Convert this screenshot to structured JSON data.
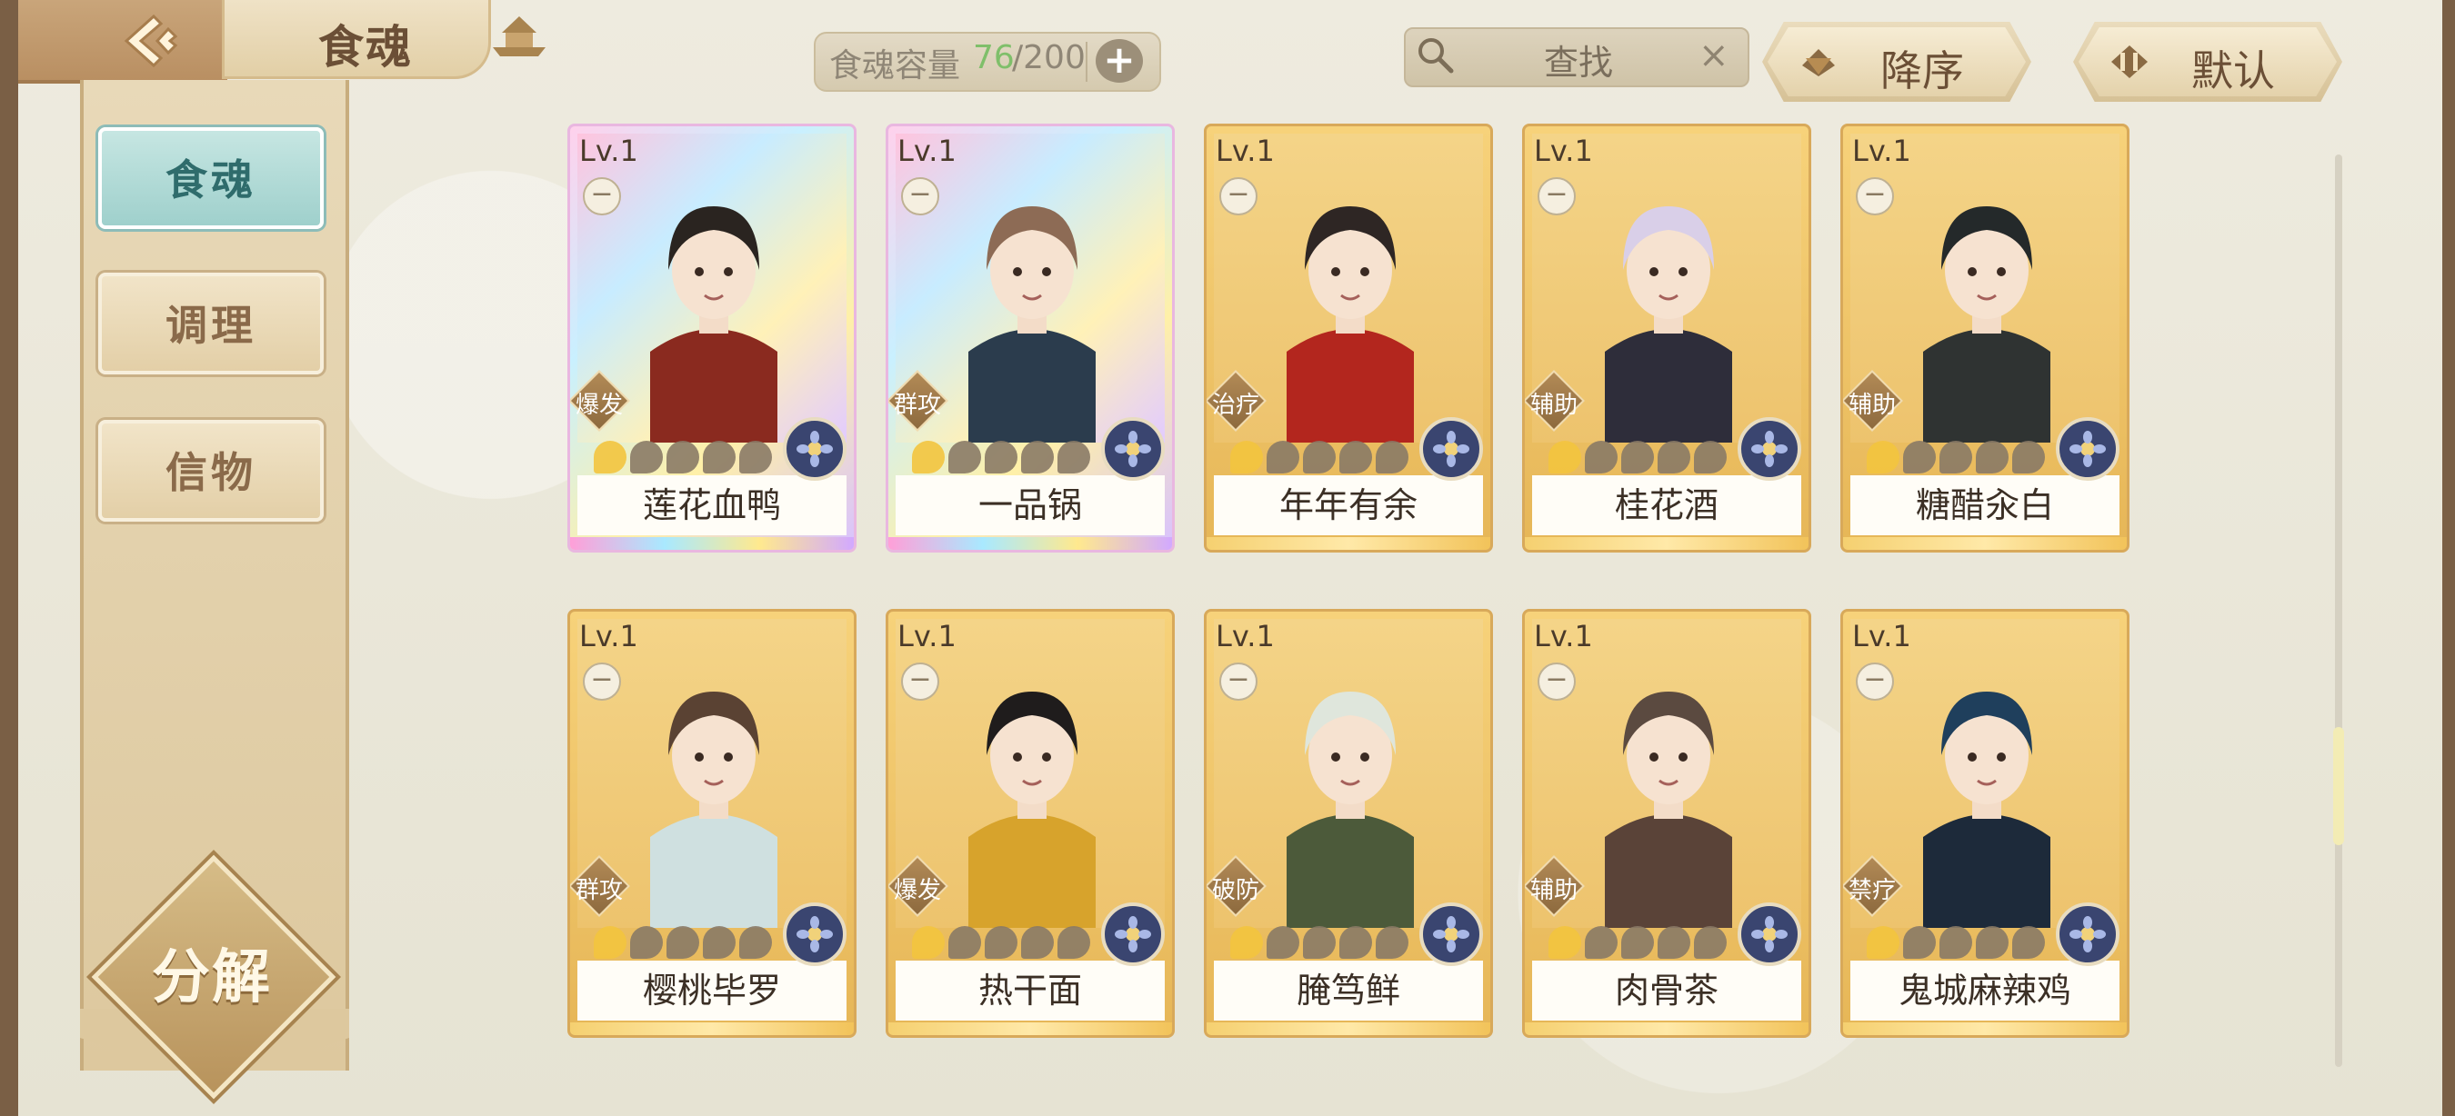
{
  "header": {
    "title": "食魂",
    "capacity_label": "食魂容量",
    "capacity_current": "76",
    "capacity_max": "/200",
    "capacity_add": "+",
    "search_text": "查找",
    "search_clear": "×",
    "sort_order_label": "降序",
    "sort_mode_label": "默认"
  },
  "sidebar": {
    "tabs": [
      {
        "label": "食魂"
      },
      {
        "label": "调理"
      },
      {
        "label": "信物"
      }
    ],
    "decompose_label": "分解"
  },
  "cards": [
    {
      "lv": "Lv.1",
      "name": "莲花血鸭",
      "role": "爆发",
      "rarity": "rainbow",
      "hair": "#2a2420",
      "outfit": "#8a2a1f"
    },
    {
      "lv": "Lv.1",
      "name": "一品锅",
      "role": "群攻",
      "rarity": "rainbow",
      "hair": "#8d6b55",
      "outfit": "#2b3c4d"
    },
    {
      "lv": "Lv.1",
      "name": "年年有余",
      "role": "治疗",
      "rarity": "gold",
      "hair": "#2e2624",
      "outfit": "#b3261e"
    },
    {
      "lv": "Lv.1",
      "name": "桂花酒",
      "role": "辅助",
      "rarity": "gold",
      "hair": "#d9cfe8",
      "outfit": "#2e2d3a"
    },
    {
      "lv": "Lv.1",
      "name": "糖醋汆白",
      "role": "辅助",
      "rarity": "gold",
      "hair": "#24292a",
      "outfit": "#2f3332"
    },
    {
      "lv": "Lv.1",
      "name": "樱桃毕罗",
      "role": "群攻",
      "rarity": "gold",
      "hair": "#5a4233",
      "outfit": "#cfe0e0"
    },
    {
      "lv": "Lv.1",
      "name": "热干面",
      "role": "爆发",
      "rarity": "gold",
      "hair": "#1f1c1c",
      "outfit": "#d7a32c"
    },
    {
      "lv": "Lv.1",
      "name": "腌笃鲜",
      "role": "破防",
      "rarity": "gold",
      "hair": "#dfe6dc",
      "outfit": "#4c5a3a"
    },
    {
      "lv": "Lv.1",
      "name": "肉骨茶",
      "role": "辅助",
      "rarity": "gold",
      "hair": "#5b4a40",
      "outfit": "#5a4338"
    },
    {
      "lv": "Lv.1",
      "name": "鬼城麻辣鸡",
      "role": "禁疗",
      "rarity": "gold",
      "hair": "#1f3f5c",
      "outfit": "#1d2a3a"
    }
  ]
}
